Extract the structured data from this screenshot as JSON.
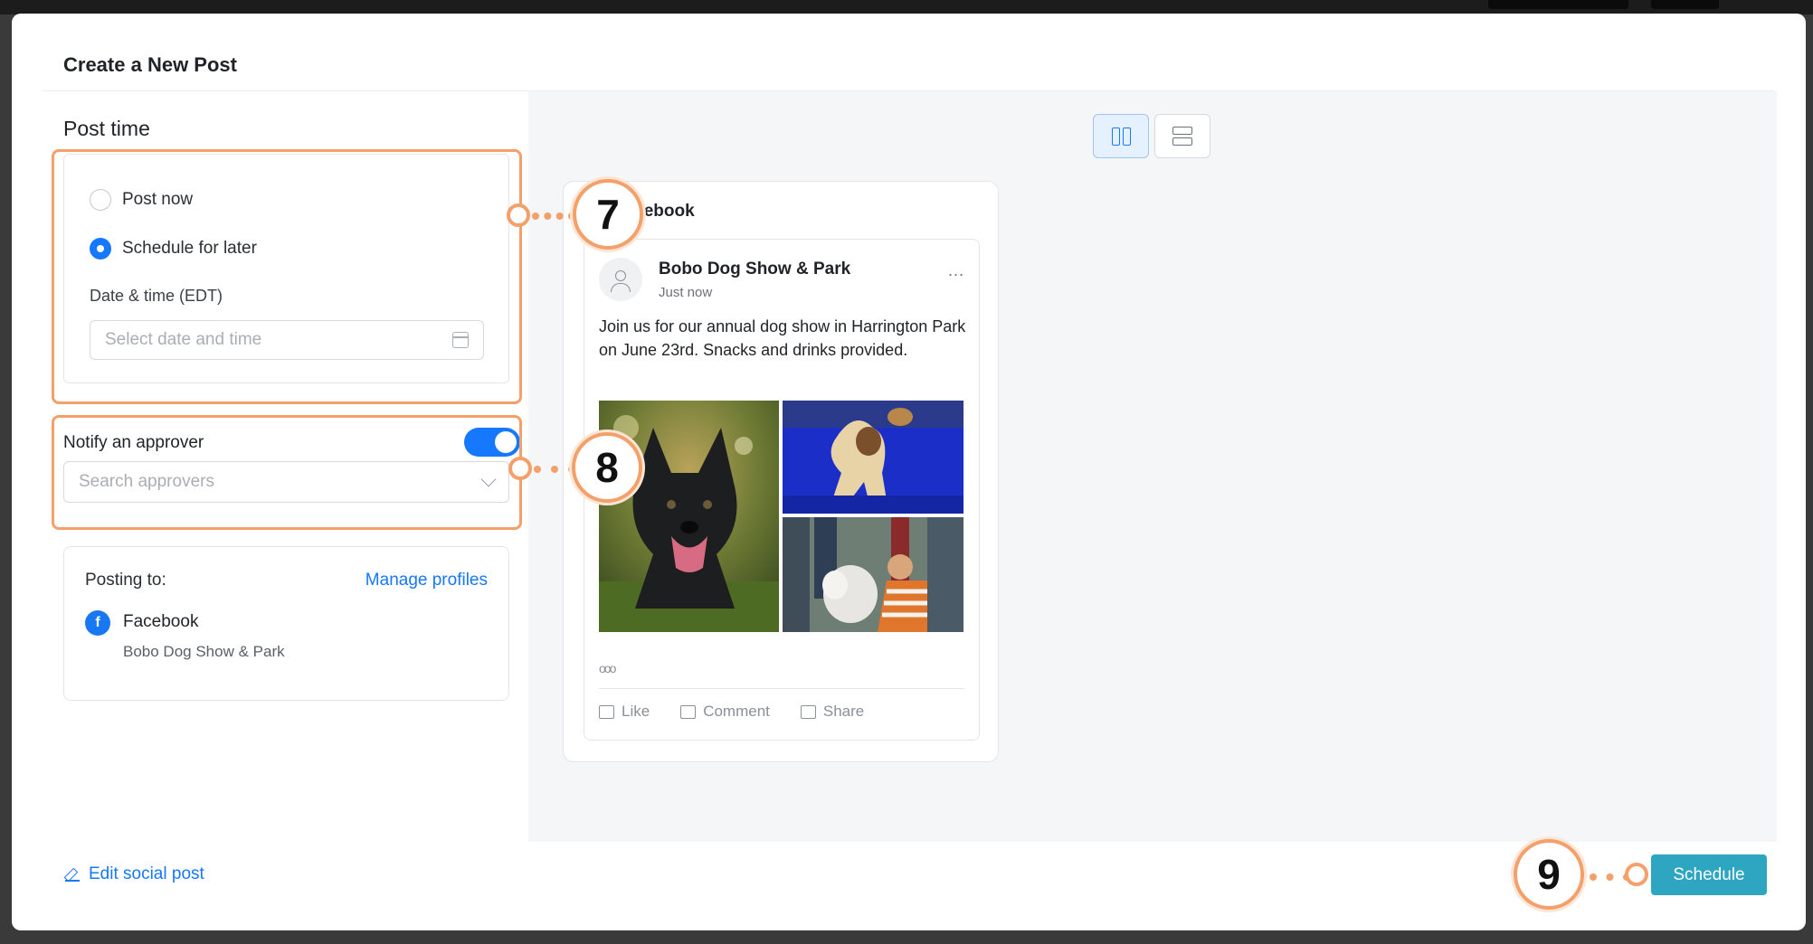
{
  "modal": {
    "title": "Create a New Post"
  },
  "post_time": {
    "heading": "Post time",
    "options": [
      {
        "label": "Post now",
        "selected": false
      },
      {
        "label": "Schedule for later",
        "selected": true
      }
    ],
    "datetime_label": "Date & time (EDT)",
    "datetime_placeholder": "Select date and time"
  },
  "approver": {
    "label": "Notify an approver",
    "toggle_on": true,
    "search_placeholder": "Search approvers"
  },
  "posting_to": {
    "label": "Posting to:",
    "manage_link": "Manage profiles",
    "network": "Facebook",
    "network_icon": "f",
    "profile": "Bobo Dog Show & Park"
  },
  "preview": {
    "header": "Facebook",
    "page_name": "Bobo Dog Show & Park",
    "time": "Just now",
    "more": "...",
    "text": "Join us for our annual dog show in Harrington Park on June 23rd. Snacks and drinks provided.",
    "reactions": "ooo",
    "actions": {
      "like": "Like",
      "comment": "Comment",
      "share": "Share"
    }
  },
  "footer": {
    "edit_link": "Edit social post",
    "schedule_button": "Schedule"
  },
  "annotations": [
    "7",
    "8",
    "9"
  ],
  "colors": {
    "primary": "#1677ff",
    "schedule_button": "#2ea6c1",
    "annotation": "#f4a06a",
    "facebook": "#1877f2"
  }
}
